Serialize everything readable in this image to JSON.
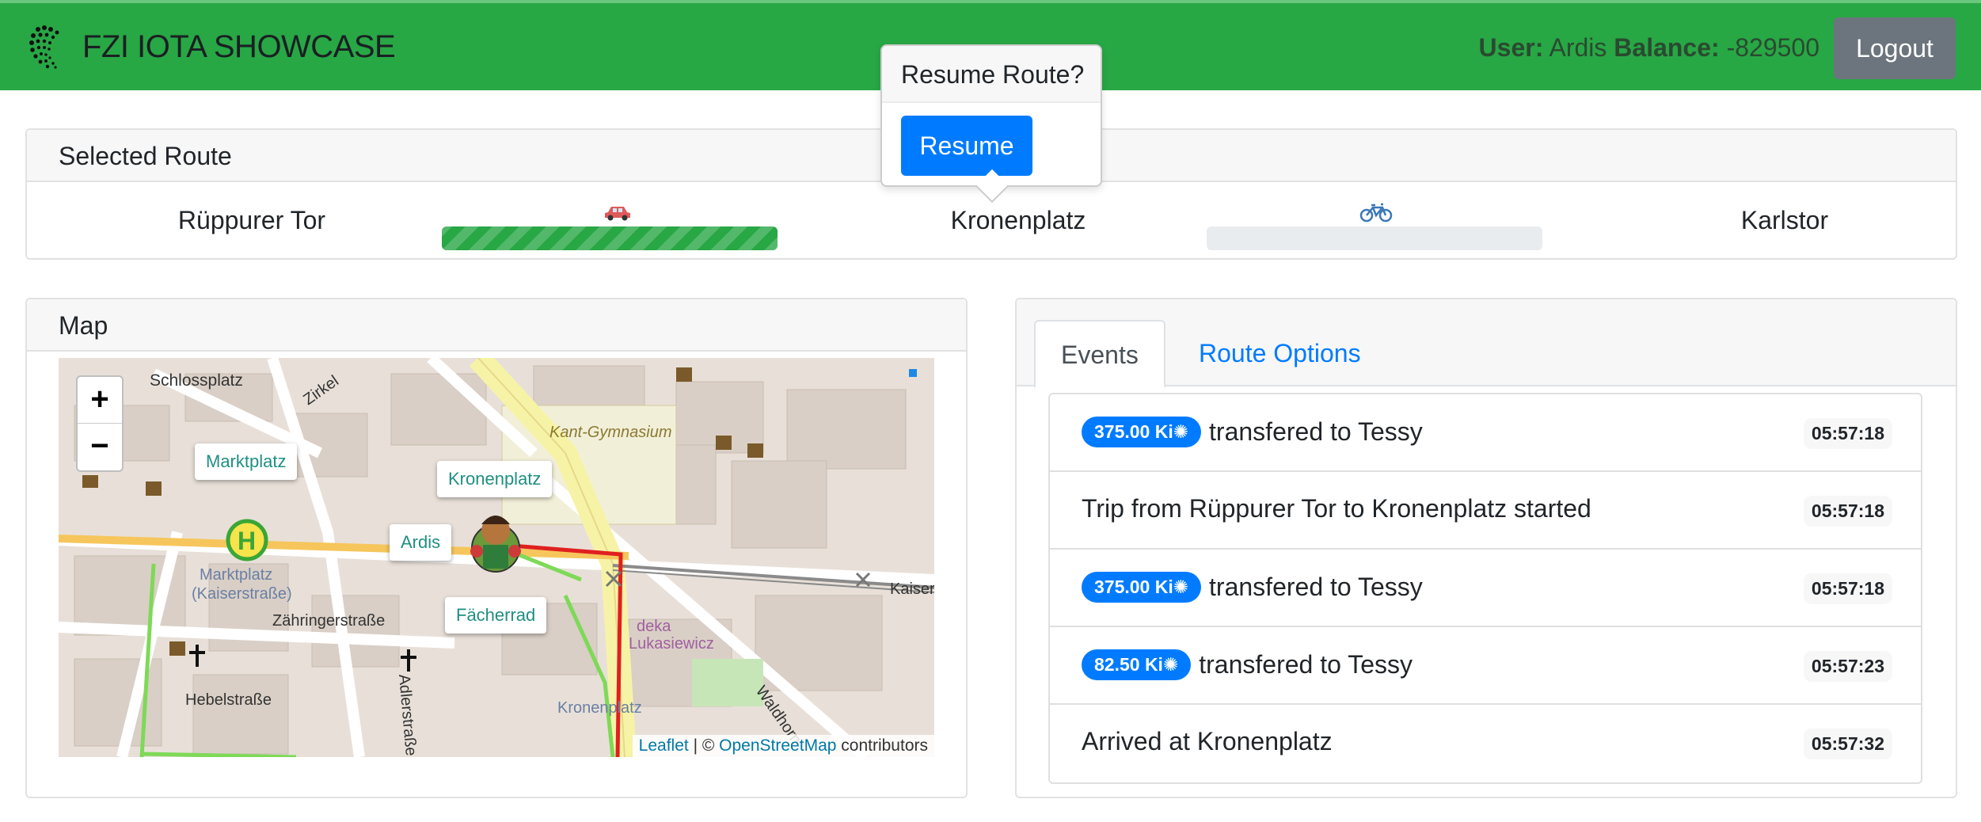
{
  "navbar": {
    "brand": "FZI IOTA SHOWCASE",
    "user_label": "User:",
    "user_name": "Ardis",
    "balance_label": "Balance:",
    "balance_value": "-829500",
    "logout_label": "Logout"
  },
  "route": {
    "header": "Selected Route",
    "stops": [
      "Rüppurer Tor",
      "Kronenplatz",
      "Karlstor"
    ],
    "segments": [
      {
        "vehicle": "car-icon",
        "progress": 1.0
      },
      {
        "vehicle": "bicycle-icon",
        "progress": 0.0
      }
    ]
  },
  "popover": {
    "title": "Resume Route?",
    "button": "Resume"
  },
  "map": {
    "header": "Map",
    "zoom_in": "+",
    "zoom_out": "−",
    "markers": {
      "marktplatz": "Marktplatz",
      "kronenplatz": "Kronenplatz",
      "ardis": "Ardis",
      "faecherrad": "Fächerrad"
    },
    "labels": {
      "schlossplatz": "Schlossplatz",
      "kant": "Kant-Gymnasium",
      "marktplatz_street": "Marktplatz",
      "kaiserstrasse_street": "(Kaiserstraße)",
      "zaehringer": "Zähringerstraße",
      "hebel": "Hebelstraße",
      "adler": "Adlerstraße",
      "kronenplatz_street": "Kronenplatz",
      "kaiser": "Kaiser",
      "zirkel": "Zirkel",
      "deka": "deka",
      "lukasiewicz": "Lukasiewicz",
      "waldhorn": "Waldhorn"
    },
    "attribution": {
      "leaflet": "Leaflet",
      "sep": " | © ",
      "osm": "OpenStreetMap",
      "contrib": " contributors"
    }
  },
  "events": {
    "tabs": [
      "Events",
      "Route Options"
    ],
    "items": [
      {
        "badge": "375.00 Ki",
        "text": "transfered to Tessy",
        "time": "05:57:18"
      },
      {
        "badge": "",
        "text": "Trip from Rüppurer Tor to Kronenplatz started",
        "time": "05:57:18"
      },
      {
        "badge": "375.00 Ki",
        "text": "transfered to Tessy",
        "time": "05:57:18"
      },
      {
        "badge": "82.50 Ki",
        "text": "transfered to Tessy",
        "time": "05:57:23"
      },
      {
        "badge": "",
        "text": "Arrived at Kronenplatz",
        "time": "05:57:32"
      }
    ]
  },
  "colors": {
    "navbar": "#28a745",
    "primary": "#007bff",
    "secondary": "#6c757d",
    "route_line": "#e02020",
    "bike_line": "#7ed957"
  }
}
